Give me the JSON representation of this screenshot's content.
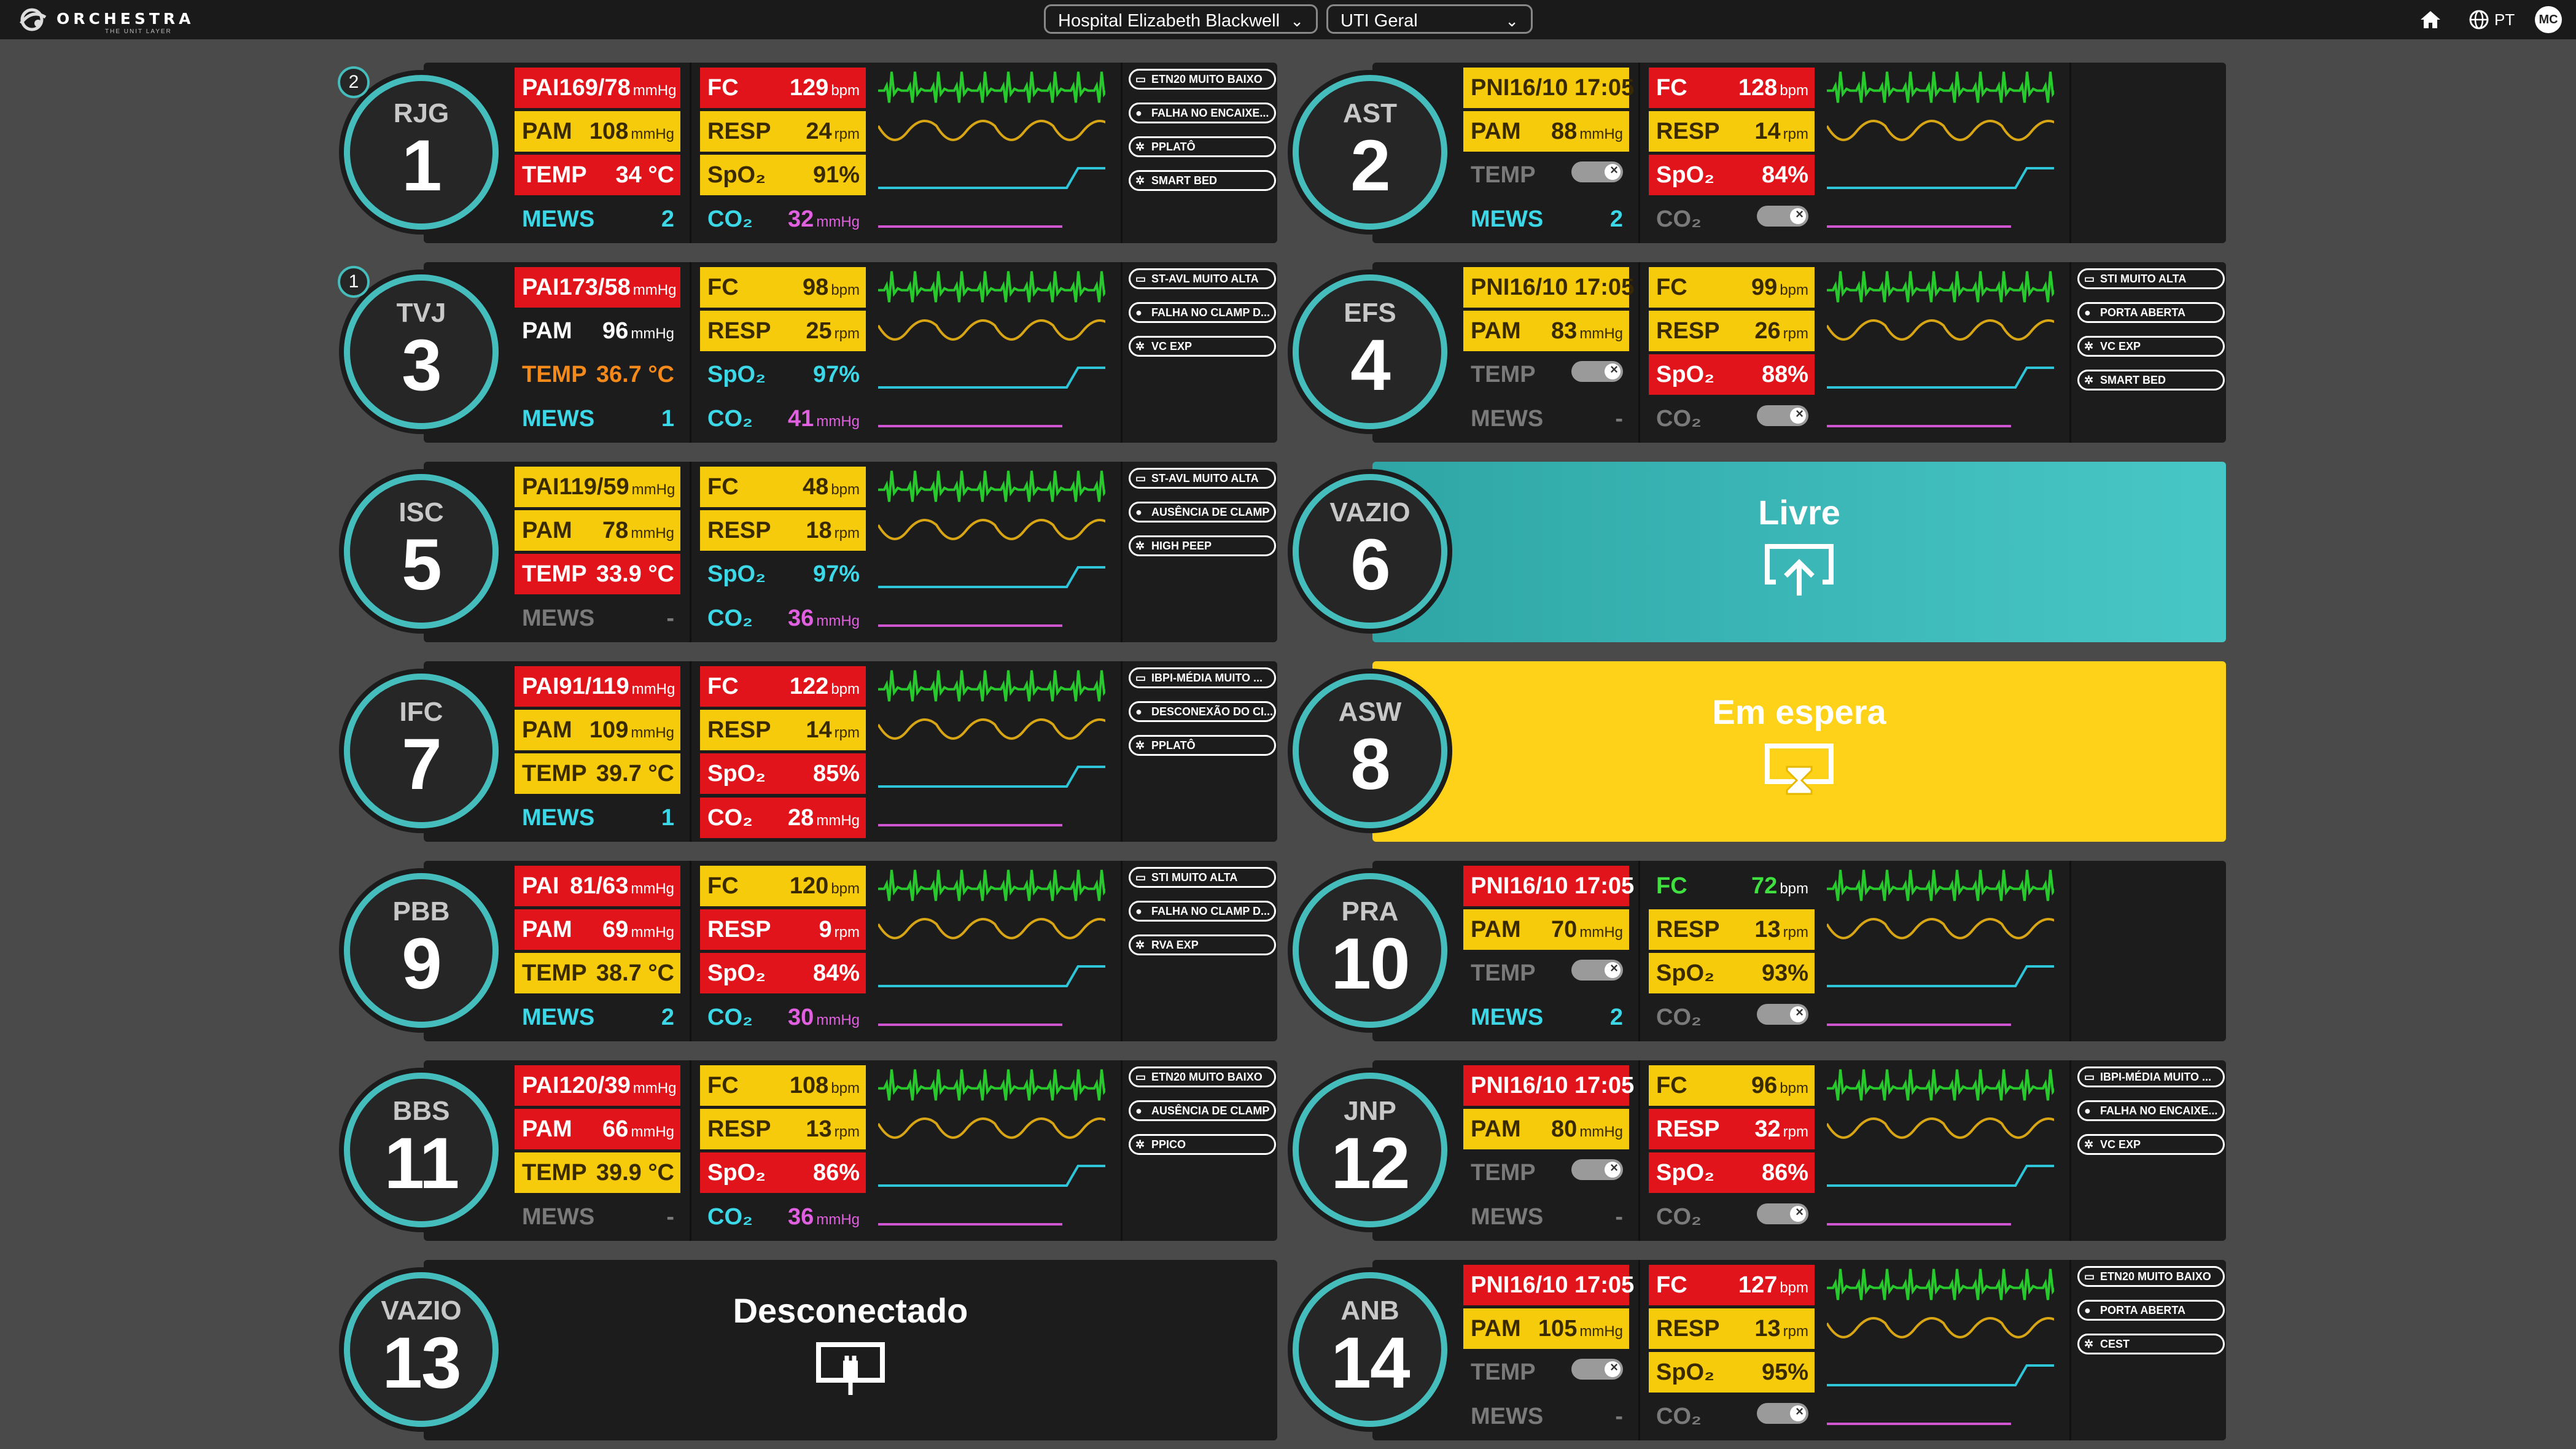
{
  "header": {
    "logo_text": "ORCHESTRA",
    "logo_subtext": "THE UNIT LAYER",
    "hospital": "Hospital Elizabeth Blackwell",
    "unit": "UTI Geral",
    "language": "PT",
    "user_initials": "MC"
  },
  "beds": [
    {
      "num": "1",
      "init": "RJG",
      "badge": "2",
      "left": [
        {
          "l": "PAI",
          "v": "169/78",
          "u": "mmHg",
          "s": "red"
        },
        {
          "l": "PAM",
          "v": "108",
          "u": "mmHg",
          "s": "yellow"
        },
        {
          "l": "TEMP",
          "v": "34 °C",
          "u": "",
          "s": "red"
        },
        {
          "l": "MEWS",
          "v": "2",
          "u": "",
          "s": "cyan"
        }
      ],
      "mid": [
        {
          "l": "FC",
          "v": "129",
          "u": "bpm",
          "s": "red"
        },
        {
          "l": "RESP",
          "v": "24",
          "u": "rpm",
          "s": "yellow"
        },
        {
          "l": "SpO₂",
          "v": "91%",
          "u": "",
          "s": "yellow"
        },
        {
          "l": "CO₂",
          "v": "32",
          "u": "mmHg",
          "s": "mag"
        }
      ],
      "alarms": [
        "ETN20 MUITO BAIXO",
        "FALHA NO ENCAIXE...",
        "PPLATÔ",
        "SMART BED"
      ]
    },
    {
      "num": "2",
      "init": "AST",
      "left": [
        {
          "l": "PNI",
          "v": "16/10 17:05",
          "u": "",
          "s": "yellow"
        },
        {
          "l": "PAM",
          "v": "88",
          "u": "mmHg",
          "s": "yellow"
        },
        {
          "l": "TEMP",
          "v": "",
          "u": "",
          "s": "toggle"
        },
        {
          "l": "MEWS",
          "v": "2",
          "u": "",
          "s": "cyan"
        }
      ],
      "mid": [
        {
          "l": "FC",
          "v": "128",
          "u": "bpm",
          "s": "red"
        },
        {
          "l": "RESP",
          "v": "14",
          "u": "rpm",
          "s": "yellow"
        },
        {
          "l": "SpO₂",
          "v": "84%",
          "u": "",
          "s": "red"
        },
        {
          "l": "CO₂",
          "v": "",
          "u": "",
          "s": "toggle"
        }
      ],
      "alarms": []
    },
    {
      "num": "3",
      "init": "TVJ",
      "badge": "1",
      "left": [
        {
          "l": "PAI",
          "v": "173/58",
          "u": "mmHg",
          "s": "red"
        },
        {
          "l": "PAM",
          "v": "96",
          "u": "mmHg",
          "s": "dark"
        },
        {
          "l": "TEMP",
          "v": "36.7 °C",
          "u": "",
          "s": "orange"
        },
        {
          "l": "MEWS",
          "v": "1",
          "u": "",
          "s": "cyan"
        }
      ],
      "mid": [
        {
          "l": "FC",
          "v": "98",
          "u": "bpm",
          "s": "yellow"
        },
        {
          "l": "RESP",
          "v": "25",
          "u": "rpm",
          "s": "yellow"
        },
        {
          "l": "SpO₂",
          "v": "97%",
          "u": "",
          "s": "cyan"
        },
        {
          "l": "CO₂",
          "v": "41",
          "u": "mmHg",
          "s": "mag"
        }
      ],
      "alarms": [
        "ST-AVL MUITO ALTA",
        "FALHA NO CLAMP D...",
        "VC EXP"
      ]
    },
    {
      "num": "4",
      "init": "EFS",
      "left": [
        {
          "l": "PNI",
          "v": "16/10 17:05",
          "u": "",
          "s": "yellow"
        },
        {
          "l": "PAM",
          "v": "83",
          "u": "mmHg",
          "s": "yellow"
        },
        {
          "l": "TEMP",
          "v": "",
          "u": "",
          "s": "toggle"
        },
        {
          "l": "MEWS",
          "v": "-",
          "u": "",
          "s": "gray"
        }
      ],
      "mid": [
        {
          "l": "FC",
          "v": "99",
          "u": "bpm",
          "s": "yellow"
        },
        {
          "l": "RESP",
          "v": "26",
          "u": "rpm",
          "s": "yellow"
        },
        {
          "l": "SpO₂",
          "v": "88%",
          "u": "",
          "s": "red"
        },
        {
          "l": "CO₂",
          "v": "",
          "u": "",
          "s": "toggle"
        }
      ],
      "alarms": [
        "STI MUITO ALTA",
        "PORTA ABERTA",
        "VC EXP",
        "SMART BED"
      ]
    },
    {
      "num": "5",
      "init": "ISC",
      "left": [
        {
          "l": "PAI",
          "v": "119/59",
          "u": "mmHg",
          "s": "yellow"
        },
        {
          "l": "PAM",
          "v": "78",
          "u": "mmHg",
          "s": "yellow"
        },
        {
          "l": "TEMP",
          "v": "33.9 °C",
          "u": "",
          "s": "red"
        },
        {
          "l": "MEWS",
          "v": "-",
          "u": "",
          "s": "gray"
        }
      ],
      "mid": [
        {
          "l": "FC",
          "v": "48",
          "u": "bpm",
          "s": "yellow"
        },
        {
          "l": "RESP",
          "v": "18",
          "u": "rpm",
          "s": "yellow"
        },
        {
          "l": "SpO₂",
          "v": "97%",
          "u": "",
          "s": "cyan"
        },
        {
          "l": "CO₂",
          "v": "36",
          "u": "mmHg",
          "s": "mag"
        }
      ],
      "alarms": [
        "ST-AVL MUITO ALTA",
        "AUSÊNCIA DE CLAMP",
        "HIGH PEEP"
      ]
    },
    {
      "num": "6",
      "init": "VAZIO",
      "status": "Livre",
      "panel": "teal"
    },
    {
      "num": "7",
      "init": "IFC",
      "left": [
        {
          "l": "PAI",
          "v": "91/119",
          "u": "mmHg",
          "s": "red"
        },
        {
          "l": "PAM",
          "v": "109",
          "u": "mmHg",
          "s": "yellow"
        },
        {
          "l": "TEMP",
          "v": "39.7 °C",
          "u": "",
          "s": "yellow"
        },
        {
          "l": "MEWS",
          "v": "1",
          "u": "",
          "s": "cyan"
        }
      ],
      "mid": [
        {
          "l": "FC",
          "v": "122",
          "u": "bpm",
          "s": "red"
        },
        {
          "l": "RESP",
          "v": "14",
          "u": "rpm",
          "s": "yellow"
        },
        {
          "l": "SpO₂",
          "v": "85%",
          "u": "",
          "s": "red"
        },
        {
          "l": "CO₂",
          "v": "28",
          "u": "mmHg",
          "s": "red"
        }
      ],
      "alarms": [
        "IBPI-MÉDIA MUITO ...",
        "DESCONEXÃO DO CI...",
        "PPLATÔ"
      ]
    },
    {
      "num": "8",
      "init": "ASW",
      "status": "Em espera",
      "panel": "yellow"
    },
    {
      "num": "9",
      "init": "PBB",
      "left": [
        {
          "l": "PAI",
          "v": "81/63",
          "u": "mmHg",
          "s": "red"
        },
        {
          "l": "PAM",
          "v": "69",
          "u": "mmHg",
          "s": "red"
        },
        {
          "l": "TEMP",
          "v": "38.7 °C",
          "u": "",
          "s": "yellow"
        },
        {
          "l": "MEWS",
          "v": "2",
          "u": "",
          "s": "cyan"
        }
      ],
      "mid": [
        {
          "l": "FC",
          "v": "120",
          "u": "bpm",
          "s": "yellow"
        },
        {
          "l": "RESP",
          "v": "9",
          "u": "rpm",
          "s": "red"
        },
        {
          "l": "SpO₂",
          "v": "84%",
          "u": "",
          "s": "red"
        },
        {
          "l": "CO₂",
          "v": "30",
          "u": "mmHg",
          "s": "mag"
        }
      ],
      "alarms": [
        "STI MUITO ALTA",
        "FALHA NO CLAMP D...",
        "RVA EXP"
      ]
    },
    {
      "num": "10",
      "init": "PRA",
      "left": [
        {
          "l": "PNI",
          "v": "16/10 17:05",
          "u": "",
          "s": "red"
        },
        {
          "l": "PAM",
          "v": "70",
          "u": "mmHg",
          "s": "yellow"
        },
        {
          "l": "TEMP",
          "v": "",
          "u": "",
          "s": "toggle"
        },
        {
          "l": "MEWS",
          "v": "2",
          "u": "",
          "s": "cyan"
        }
      ],
      "mid": [
        {
          "l": "FC",
          "v": "72",
          "u": "bpm",
          "s": "green"
        },
        {
          "l": "RESP",
          "v": "13",
          "u": "rpm",
          "s": "yellow"
        },
        {
          "l": "SpO₂",
          "v": "93%",
          "u": "",
          "s": "yellow"
        },
        {
          "l": "CO₂",
          "v": "",
          "u": "",
          "s": "toggle"
        }
      ],
      "alarms": []
    },
    {
      "num": "11",
      "init": "BBS",
      "left": [
        {
          "l": "PAI",
          "v": "120/39",
          "u": "mmHg",
          "s": "red"
        },
        {
          "l": "PAM",
          "v": "66",
          "u": "mmHg",
          "s": "red"
        },
        {
          "l": "TEMP",
          "v": "39.9 °C",
          "u": "",
          "s": "yellow"
        },
        {
          "l": "MEWS",
          "v": "-",
          "u": "",
          "s": "gray"
        }
      ],
      "mid": [
        {
          "l": "FC",
          "v": "108",
          "u": "bpm",
          "s": "yellow"
        },
        {
          "l": "RESP",
          "v": "13",
          "u": "rpm",
          "s": "yellow"
        },
        {
          "l": "SpO₂",
          "v": "86%",
          "u": "",
          "s": "red"
        },
        {
          "l": "CO₂",
          "v": "36",
          "u": "mmHg",
          "s": "mag"
        }
      ],
      "alarms": [
        "ETN20 MUITO BAIXO",
        "AUSÊNCIA DE CLAMP",
        "PPICO"
      ]
    },
    {
      "num": "12",
      "init": "JNP",
      "left": [
        {
          "l": "PNI",
          "v": "16/10 17:05",
          "u": "",
          "s": "red"
        },
        {
          "l": "PAM",
          "v": "80",
          "u": "mmHg",
          "s": "yellow"
        },
        {
          "l": "TEMP",
          "v": "",
          "u": "",
          "s": "toggle"
        },
        {
          "l": "MEWS",
          "v": "-",
          "u": "",
          "s": "gray"
        }
      ],
      "mid": [
        {
          "l": "FC",
          "v": "96",
          "u": "bpm",
          "s": "yellow"
        },
        {
          "l": "RESP",
          "v": "32",
          "u": "rpm",
          "s": "red"
        },
        {
          "l": "SpO₂",
          "v": "86%",
          "u": "",
          "s": "red"
        },
        {
          "l": "CO₂",
          "v": "",
          "u": "",
          "s": "toggle"
        }
      ],
      "alarms": [
        "IBPI-MÉDIA MUITO ...",
        "FALHA NO ENCAIXE...",
        "VC EXP"
      ]
    },
    {
      "num": "13",
      "init": "VAZIO",
      "status": "Desconectado",
      "panel": "dark"
    },
    {
      "num": "14",
      "init": "ANB",
      "left": [
        {
          "l": "PNI",
          "v": "16/10 17:05",
          "u": "",
          "s": "red"
        },
        {
          "l": "PAM",
          "v": "105",
          "u": "mmHg",
          "s": "yellow"
        },
        {
          "l": "TEMP",
          "v": "",
          "u": "",
          "s": "toggle"
        },
        {
          "l": "MEWS",
          "v": "-",
          "u": "",
          "s": "gray"
        }
      ],
      "mid": [
        {
          "l": "FC",
          "v": "127",
          "u": "bpm",
          "s": "red"
        },
        {
          "l": "RESP",
          "v": "13",
          "u": "rpm",
          "s": "yellow"
        },
        {
          "l": "SpO₂",
          "v": "95%",
          "u": "",
          "s": "yellow"
        },
        {
          "l": "CO₂",
          "v": "",
          "u": "",
          "s": "toggle"
        }
      ],
      "alarms": [
        "ETN20 MUITO BAIXO",
        "PORTA ABERTA",
        "CEST"
      ]
    }
  ],
  "colors": {
    "critical": "#e0141a",
    "warning": "#f6cb0c",
    "ring": "#46bdbd",
    "free": "#46c4c4",
    "waiting": "#ffd21a"
  }
}
